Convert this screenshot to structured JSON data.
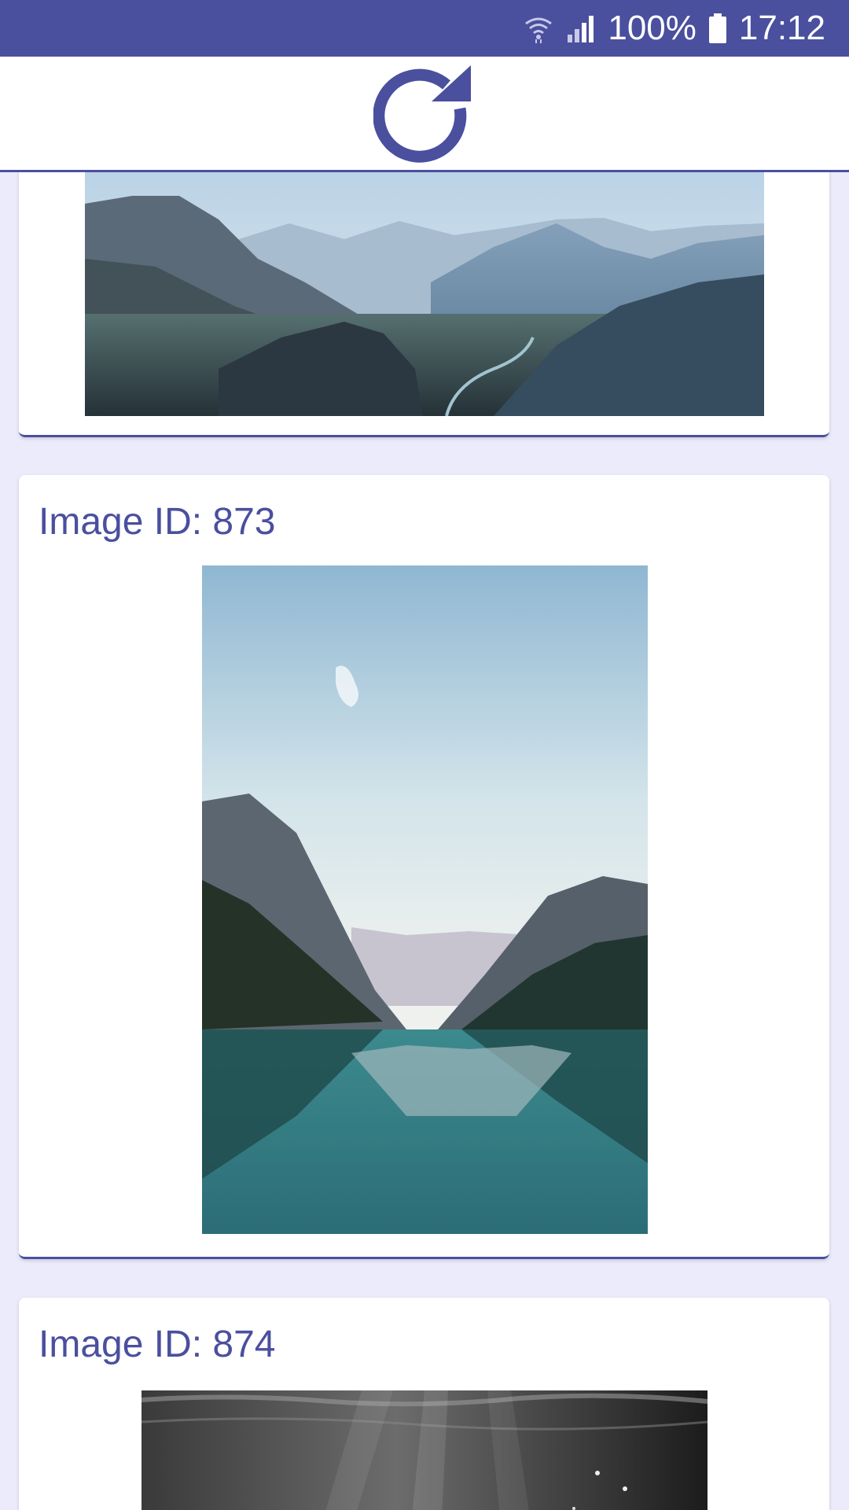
{
  "status_bar": {
    "battery": "100%",
    "time": "17:12",
    "icons": [
      "wifi-icon",
      "signal-icon",
      "battery-icon"
    ]
  },
  "header": {
    "refresh_icon": "refresh-icon"
  },
  "cards": [
    {
      "title": ""
    },
    {
      "title": "Image ID: 873"
    },
    {
      "title": "Image ID: 874"
    }
  ],
  "colors": {
    "primary": "#4a4f9e",
    "background": "#ebebfb",
    "card": "#ffffff"
  }
}
